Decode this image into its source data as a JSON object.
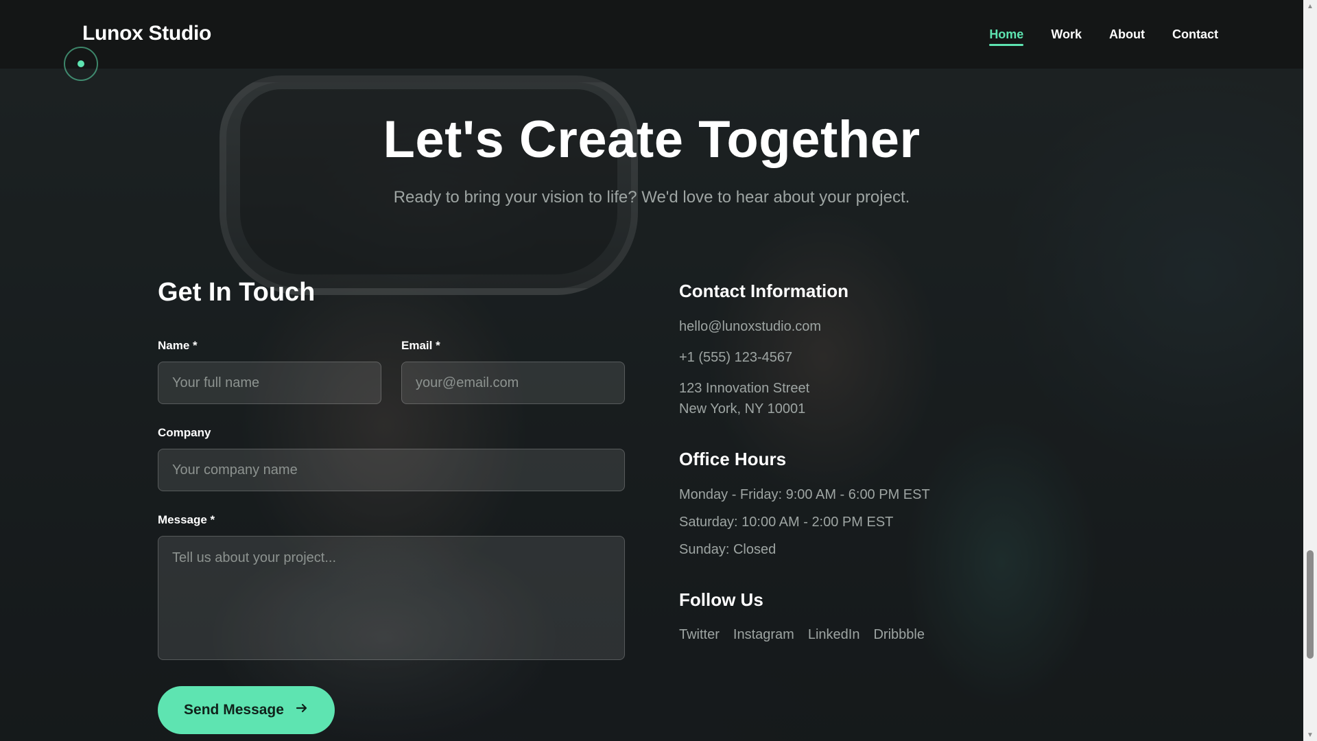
{
  "brand": {
    "name": "Lunox Studio"
  },
  "nav": {
    "items": [
      {
        "label": "Home",
        "active": true
      },
      {
        "label": "Work",
        "active": false
      },
      {
        "label": "About",
        "active": false
      },
      {
        "label": "Contact",
        "active": false
      }
    ]
  },
  "hero": {
    "title": "Let's Create Together",
    "subtitle": "Ready to bring your vision to life? We'd love to hear about your project."
  },
  "form": {
    "title": "Get In Touch",
    "name": {
      "label": "Name *",
      "placeholder": "Your full name",
      "value": ""
    },
    "email": {
      "label": "Email *",
      "placeholder": "your@email.com",
      "value": ""
    },
    "company": {
      "label": "Company",
      "placeholder": "Your company name",
      "value": ""
    },
    "message": {
      "label": "Message *",
      "placeholder": "Tell us about your project...",
      "value": ""
    },
    "submit_label": "Send Message",
    "submit_icon": "arrow-right-icon"
  },
  "contact_info": {
    "title": "Contact Information",
    "email": "hello@lunoxstudio.com",
    "phone": "+1 (555) 123-4567",
    "address_line1": "123 Innovation Street",
    "address_line2": "New York, NY 10001"
  },
  "office_hours": {
    "title": "Office Hours",
    "weekdays": "Monday - Friday: 9:00 AM - 6:00 PM EST",
    "saturday": "Saturday: 10:00 AM - 2:00 PM EST",
    "sunday": "Sunday: Closed"
  },
  "follow": {
    "title": "Follow Us",
    "links": [
      "Twitter",
      "Instagram",
      "LinkedIn",
      "Dribbble"
    ]
  },
  "colors": {
    "accent": "#5ee4b1",
    "nav_bg": "#141616",
    "muted_text": "#9ea5a3"
  }
}
